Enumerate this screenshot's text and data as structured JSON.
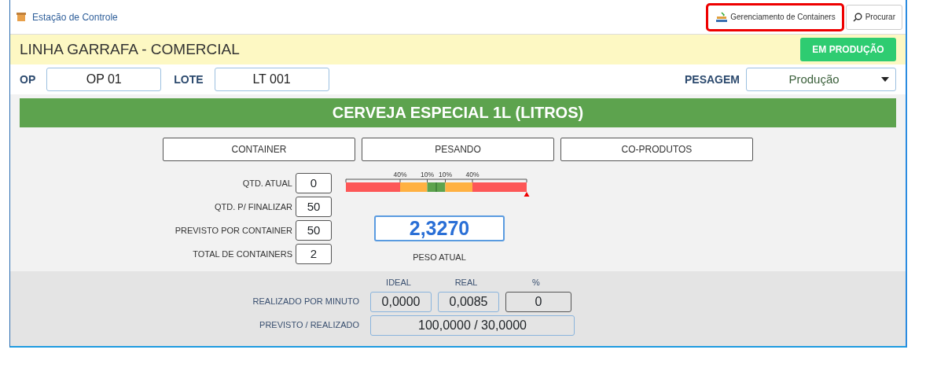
{
  "header": {
    "title": "Estação de Controle",
    "buttons": [
      {
        "kind": "containers",
        "label": "Gerenciamento de Containers",
        "highlighted": true
      },
      {
        "kind": "search",
        "label": "Procurar",
        "highlighted": false
      }
    ]
  },
  "line": {
    "title": "LINHA GARRAFA - COMERCIAL",
    "status": "EM PRODUÇÃO"
  },
  "fields": [
    {
      "label": "OP",
      "value": "OP 01"
    },
    {
      "label": "LOTE",
      "value": "LT 001"
    }
  ],
  "pesagem": {
    "label": "PESAGEM",
    "value": "Produção"
  },
  "product": "CERVEJA ESPECIAL 1L (LITROS)",
  "tabs": [
    {
      "label": "CONTAINER"
    },
    {
      "label": "PESANDO"
    },
    {
      "label": "CO-PRODUTOS"
    }
  ],
  "quantities": [
    {
      "label": "QTD. ATUAL",
      "value": "0"
    },
    {
      "label": "QTD. P/ FINALIZAR",
      "value": "50"
    },
    {
      "label": "PREVISTO POR CONTAINER",
      "value": "50"
    },
    {
      "label": "TOTAL DE CONTAINERS",
      "value": "2"
    }
  ],
  "gauge": {
    "ticks": [
      "40%",
      "10%",
      "10%",
      "40%"
    ],
    "level": 1
  },
  "weight": {
    "value": "2,3270",
    "label": "PESO ATUAL"
  },
  "rate": {
    "columns": [
      "IDEAL",
      "REAL",
      "%"
    ],
    "label": "REALIZADO POR MINUTO",
    "values": [
      "0,0000",
      "0,0085",
      "0"
    ]
  },
  "planned": {
    "label": "PREVISTO / REALIZADO",
    "value": "100,0000 / 30,0000"
  }
}
